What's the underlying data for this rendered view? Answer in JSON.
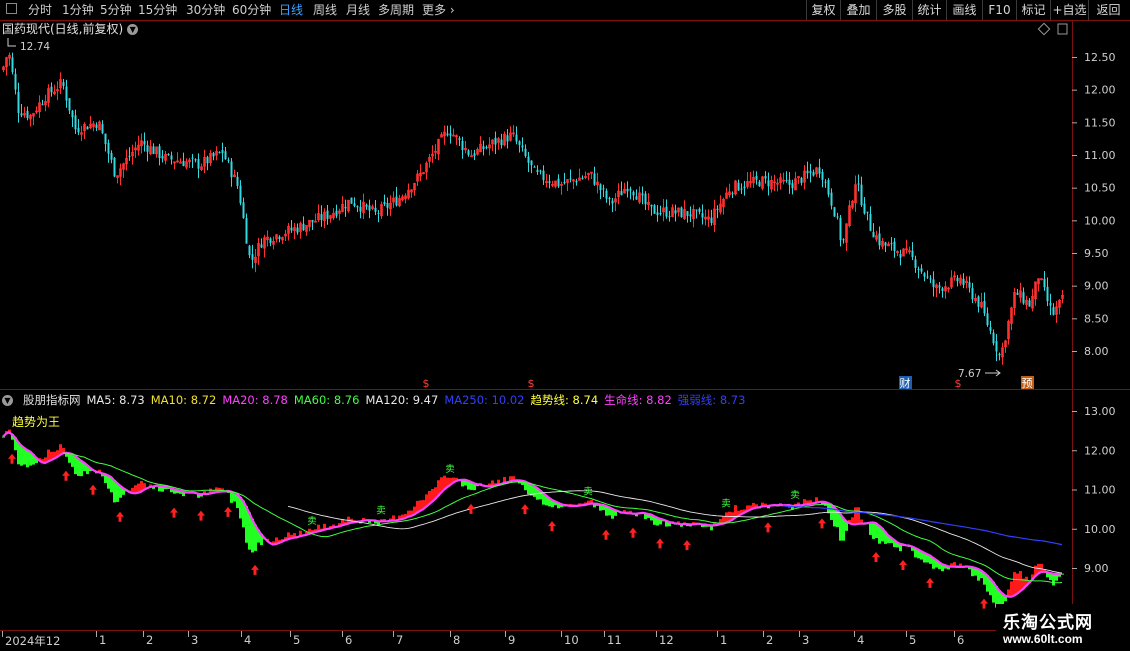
{
  "toolbar": {
    "periods": [
      "分时",
      "1分钟",
      "5分钟",
      "15分钟",
      "30分钟",
      "60分钟",
      "日线",
      "周线",
      "月线",
      "多周期",
      "更多"
    ],
    "active_period": "日线",
    "right_buttons": [
      "复权",
      "叠加",
      "多股",
      "统计",
      "画线",
      "F10",
      "标记",
      "+自选",
      "返回"
    ]
  },
  "upper_chart": {
    "title": "国药现代(日线,前复权)",
    "price_axis": [
      "12.50",
      "12.00",
      "11.50",
      "11.00",
      "10.50",
      "10.00",
      "9.50",
      "9.00",
      "8.50",
      "8.00"
    ],
    "high_label": "12.74",
    "low_label": "7.67",
    "event_markers": [
      {
        "symbol": "$",
        "color": "#ff4040"
      },
      {
        "symbol": "$",
        "color": "#ff4040"
      },
      {
        "symbol": "财",
        "color": "#ffffff",
        "bg": "#1c5fb0"
      },
      {
        "symbol": "$",
        "color": "#ff4040"
      },
      {
        "symbol": "预",
        "color": "#ffffff",
        "bg": "#c06018"
      }
    ],
    "colors": {
      "up": "#ff3030",
      "down": "#33d8e0"
    }
  },
  "lower_chart": {
    "indicator_name": "股朋指标网",
    "indicator_title": "趋势为王",
    "values": [
      {
        "label": "MA5:",
        "value": "8.73",
        "color": "#e8e8e8"
      },
      {
        "label": "MA10:",
        "value": "8.72",
        "color": "#f0e030"
      },
      {
        "label": "MA20:",
        "value": "8.78",
        "color": "#ff40ff"
      },
      {
        "label": "MA60:",
        "value": "8.76",
        "color": "#40ff40"
      },
      {
        "label": "MA120:",
        "value": "9.47",
        "color": "#e8e8e8"
      },
      {
        "label": "MA250:",
        "value": "10.02",
        "color": "#3040ff"
      },
      {
        "label": "趋势线:",
        "value": "8.74",
        "color": "#ffff40"
      },
      {
        "label": "生命线:",
        "value": "8.82",
        "color": "#ff40ff"
      },
      {
        "label": "强弱线:",
        "value": "8.73",
        "color": "#3040ff"
      }
    ],
    "price_axis": [
      "13.00",
      "12.00",
      "11.00",
      "10.00",
      "9.00"
    ],
    "buy_label": "买",
    "sell_label": "卖"
  },
  "date_axis": [
    "2024年12",
    "1",
    "2",
    "3",
    "4",
    "5",
    "6",
    "7",
    "8",
    "9",
    "10",
    "11",
    "12",
    "1",
    "2",
    "3",
    "4",
    "5",
    "6"
  ],
  "watermark": {
    "line1": "乐淘公式网",
    "line2": "www.60lt.com"
  }
}
